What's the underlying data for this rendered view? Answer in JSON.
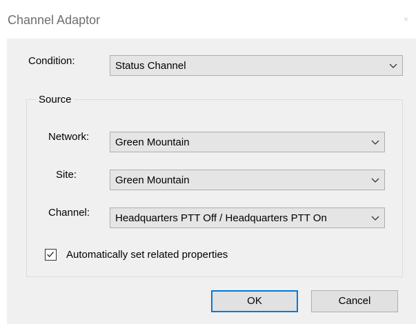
{
  "window": {
    "title": "Channel Adaptor",
    "close_glyph": "×"
  },
  "condition": {
    "label": "Condition:",
    "value": "Status Channel"
  },
  "source": {
    "title": "Source",
    "network": {
      "label": "Network:",
      "value": "Green Mountain"
    },
    "site": {
      "label": "Site:",
      "value": "Green Mountain"
    },
    "channel": {
      "label": "Channel:",
      "value": "Headquarters PTT Off / Headquarters PTT On"
    },
    "auto_props": {
      "label": "Automatically set related properties",
      "checked": true
    }
  },
  "buttons": {
    "ok": "OK",
    "cancel": "Cancel"
  },
  "icons": {
    "dropdown": "chevron-down-icon",
    "check": "checkmark-icon",
    "close": "close-icon"
  },
  "colors": {
    "client_bg": "#f0f0f0",
    "default_button_border": "#0078d7",
    "combo_bg": "#e5e5e5"
  }
}
